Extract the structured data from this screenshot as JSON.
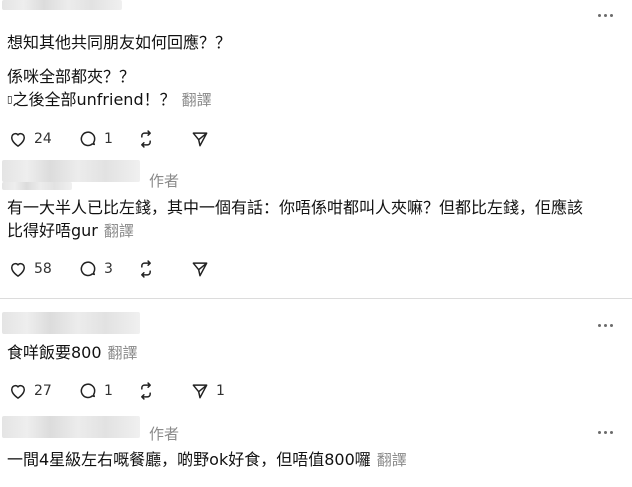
{
  "author_label": "作者",
  "translate_label": "翻譯",
  "comments": [
    {
      "lines": [
        "想知其他共同朋友如何回應？？",
        "係咪全部都夾？？",
        "之後全部unfriend！？"
      ],
      "lead_glyph": "▯",
      "actions": {
        "likes": "24",
        "replies": "1",
        "reposts": "",
        "shares": ""
      }
    },
    {
      "lines": [
        "有一大半人已比左錢，其中一個有話：你唔係咁都叫人夾嘛？但都比左錢，佢應該",
        "比得好唔gur"
      ],
      "actions": {
        "likes": "58",
        "replies": "3",
        "reposts": "",
        "shares": ""
      }
    },
    {
      "lines": [
        "食咩飯要800"
      ],
      "actions": {
        "likes": "27",
        "replies": "1",
        "reposts": "",
        "shares": "1"
      }
    },
    {
      "lines": [
        "一間4星級左右嘅餐廳，啲野ok好食，但唔值800囉"
      ]
    }
  ]
}
